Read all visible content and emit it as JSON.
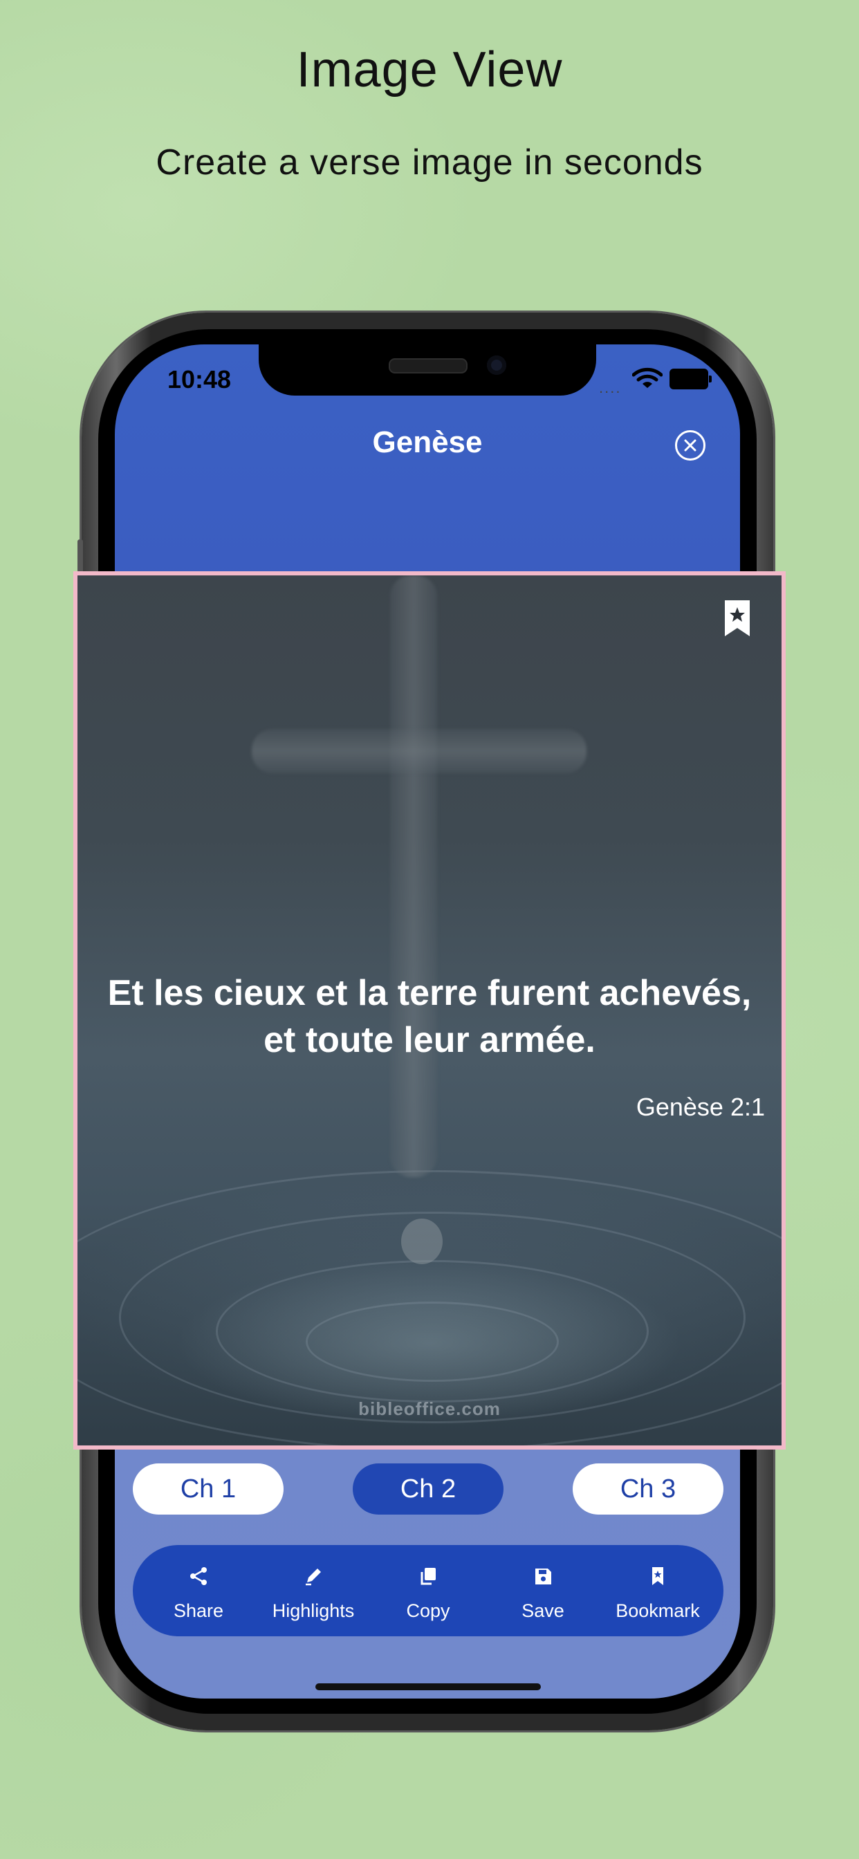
{
  "promo": {
    "title": "Image View",
    "subtitle": "Create a verse image in seconds"
  },
  "status_bar": {
    "time": "10:48",
    "signal_dots": "....",
    "icons": [
      "wifi-icon",
      "battery-icon"
    ]
  },
  "nav": {
    "title": "Genèse",
    "close_icon": "close-circle-icon"
  },
  "verse_card": {
    "text": "Et les cieux et la terre furent achevés, et toute leur armée.",
    "reference": "Genèse 2:1",
    "watermark": "bibleoffice.com",
    "bookmark_icon": "bookmark-star-icon"
  },
  "chapters": [
    {
      "label": "Ch 1",
      "selected": false
    },
    {
      "label": "Ch 2",
      "selected": true
    },
    {
      "label": "Ch 3",
      "selected": false
    }
  ],
  "actions": [
    {
      "label": "Share",
      "icon": "share-icon"
    },
    {
      "label": "Highlights",
      "icon": "pencil-icon"
    },
    {
      "label": "Copy",
      "icon": "copy-icon"
    },
    {
      "label": "Save",
      "icon": "save-icon"
    },
    {
      "label": "Bookmark",
      "icon": "bookmark-icon"
    }
  ],
  "colors": {
    "background": "#b6d9a5",
    "accent_blue": "#1e46b6",
    "card_border": "#f2b9c9"
  }
}
